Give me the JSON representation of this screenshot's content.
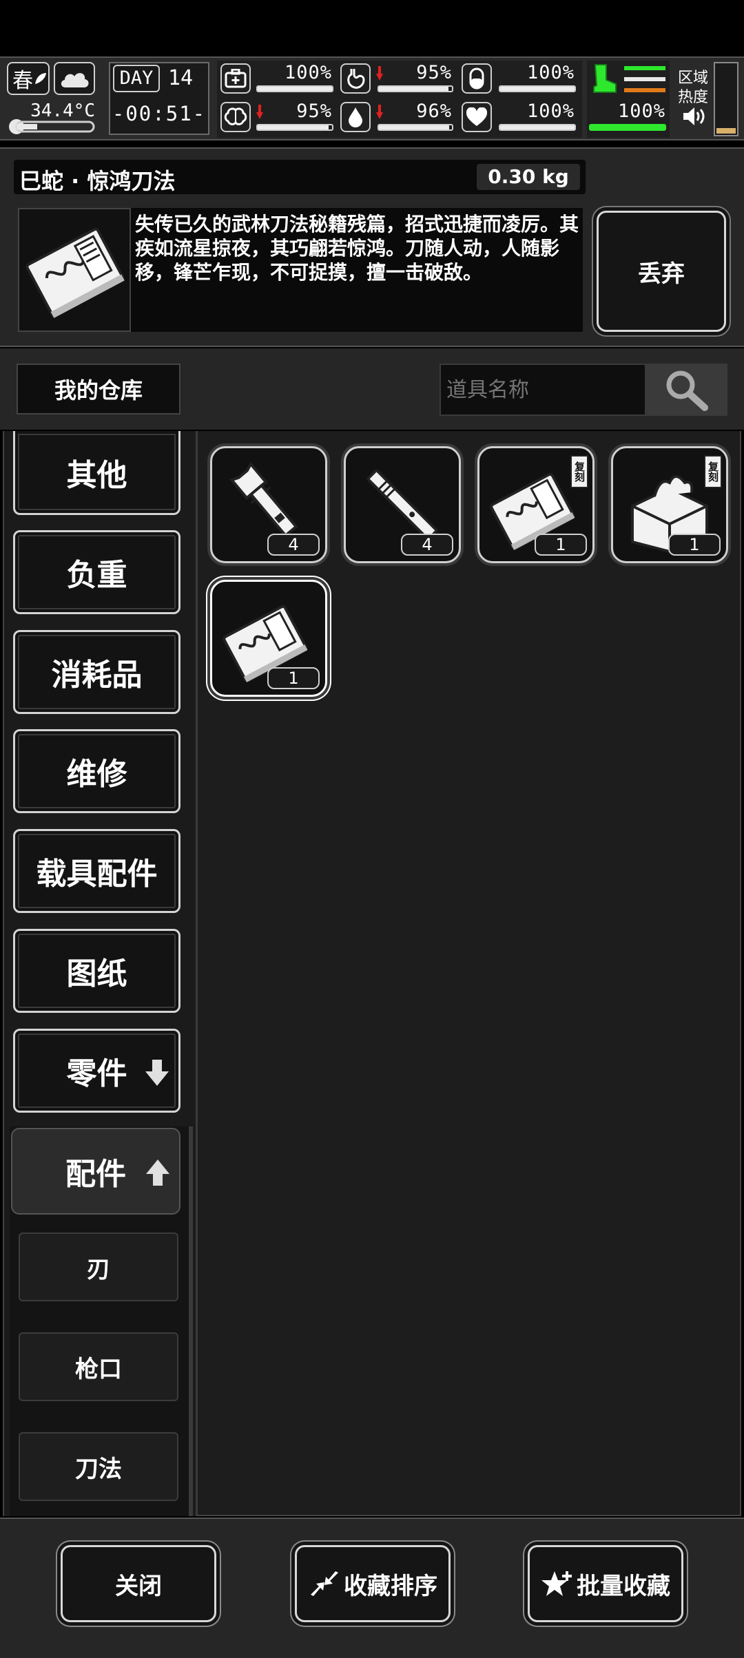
{
  "status": {
    "season": "春",
    "temperature": "34.4°C",
    "day_label": "DAY",
    "day_number": "14",
    "time": "-00:51-",
    "area_heat_label": "区域热度",
    "health_pct": "100%",
    "hunger_pct": "95%",
    "stomach_pct": "100%",
    "mental_pct": "95%",
    "thirst_pct": "96%",
    "heart_pct": "100%",
    "stamina_pct": "100%",
    "health_value": 1.0,
    "hunger_value": 0.95,
    "stomach_value": 1.0,
    "mental_value": 0.95,
    "thirst_value": 0.96,
    "heart_value": 1.0,
    "stamina_value": 1.0
  },
  "item": {
    "name": "巳蛇 · 惊鸿刀法",
    "weight": "0.30 kg",
    "description": "失传已久的武林刀法秘籍残篇，招式迅捷而凌厉。其疾如流星掠夜，其巧翩若惊鸿。刀随人动，人随影移，锋芒乍现，不可捉摸，擅一击破敌。",
    "discard_label": "丢弃"
  },
  "storage": {
    "title": "我的仓库",
    "search_placeholder": "道具名称"
  },
  "categories": [
    {
      "label": "其他"
    },
    {
      "label": "负重"
    },
    {
      "label": "消耗品"
    },
    {
      "label": "维修"
    },
    {
      "label": "载具配件"
    },
    {
      "label": "图纸"
    },
    {
      "label": "零件"
    },
    {
      "label": "配件"
    }
  ],
  "subcategories": [
    {
      "label": "刃"
    },
    {
      "label": "枪口"
    },
    {
      "label": "刀法"
    }
  ],
  "items": [
    {
      "icon": "flashlight-icon",
      "count": "4"
    },
    {
      "icon": "rod-icon",
      "count": "4"
    },
    {
      "icon": "manual-copy-icon",
      "count": "1",
      "badge": "复刻"
    },
    {
      "icon": "bag-copy-icon",
      "count": "1",
      "badge": "复刻"
    },
    {
      "icon": "manual-icon",
      "count": "1"
    }
  ],
  "footer": {
    "close_label": "关闭",
    "sort_label": "收藏排序",
    "batch_label": "批量收藏"
  },
  "colors": {
    "accent_green": "#2ee82e",
    "accent_orange": "#e07a1a",
    "alert_red": "#e02020"
  }
}
